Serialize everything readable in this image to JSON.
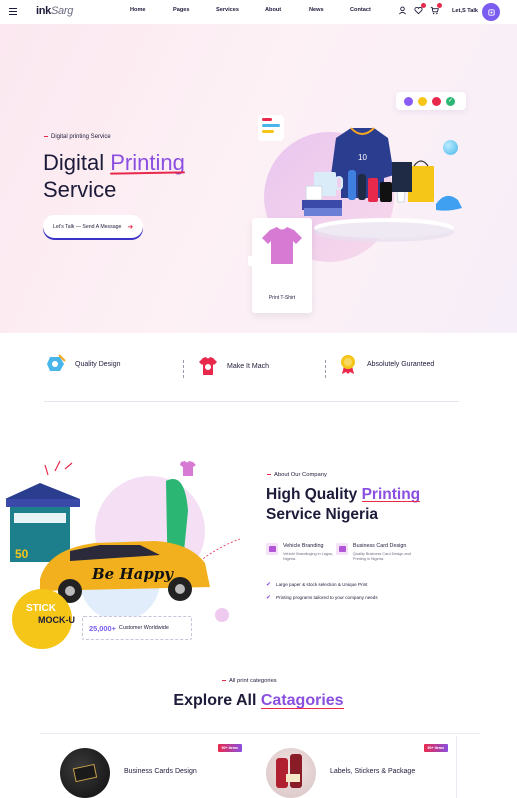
{
  "header": {
    "logo_main": "ink",
    "logo_sub": "Sarg",
    "nav": [
      "Home",
      "Pages",
      "Services",
      "About",
      "News",
      "Contact"
    ],
    "cta_label": "Let,S Talk",
    "icons": [
      "user-icon",
      "heart-icon",
      "cart-icon"
    ]
  },
  "hero": {
    "kicker": "Digital printing Service",
    "title_part1": "Digital ",
    "title_highlight": "Printing",
    "title_part2": "Service",
    "button_label": "Let's Talk — Send A Message",
    "tshirt_label": "Print T-Shirt",
    "color_dots": [
      "#8a5cf6",
      "#f5c518",
      "#e8294c",
      "#2bb673"
    ]
  },
  "features": [
    {
      "label": "Quality Design",
      "icon": "design-icon"
    },
    {
      "label": "Make It Mach",
      "icon": "tshirt-icon"
    },
    {
      "label": "Absolutely Guranteed",
      "icon": "award-icon"
    }
  ],
  "about": {
    "kicker": "About Our Company",
    "title_part1": "High Quality ",
    "title_highlight": "Printing",
    "title_part2": "Service Nigeria",
    "services": [
      {
        "title": "Vehicle Branding",
        "desc": "Vehicle Brandinging in Lagos, Nigeria."
      },
      {
        "title": "Business Card Design",
        "desc": "Quality Business Card Design and Printing in Nigeria."
      }
    ],
    "checks": [
      "Large paper & stock selection & Unique Print",
      "Printing programs tailored to your company needs"
    ],
    "customer_count": "25,000+",
    "customer_label": "Customer Worldwide",
    "art_texts": {
      "car_text": "Be Happy",
      "sticker_text": "STICK",
      "mockup_text": "MOCK-U",
      "tent_count": "50"
    }
  },
  "categories": {
    "kicker": "All print categories",
    "title_part1": "Explore All ",
    "title_highlight": "Catagories",
    "items": [
      {
        "title": "Business Cards Design",
        "tag": "50+ Items"
      },
      {
        "title": "Labels, Stickers & Package",
        "tag": "80+ Items"
      }
    ]
  },
  "colors": {
    "accent_purple": "#8a4fe0",
    "accent_red": "#e8294c",
    "dark_text": "#1d1b3a"
  }
}
